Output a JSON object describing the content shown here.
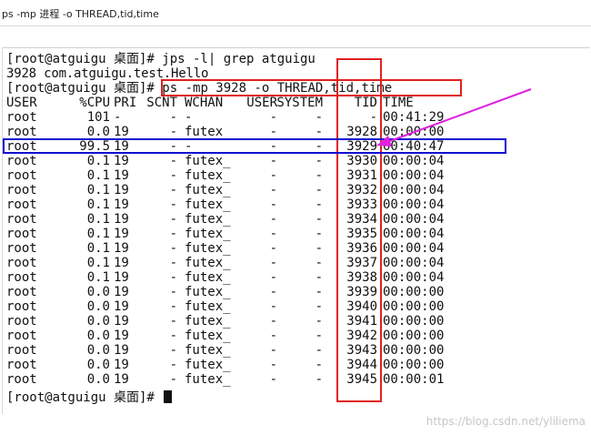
{
  "window": {
    "title": "ps -mp 进程 -o THREAD,tid,time"
  },
  "terminal": {
    "cmd1": "[root@atguigu 桌面]# jps -l| grep atguigu",
    "out1": "3928 com.atguigu.test.Hello",
    "cmd2_prefix": "[root@atguigu 桌面]# ",
    "cmd2_command": "ps -mp 3928 -o THREAD,tid,time",
    "header": [
      "USER",
      "%CPU",
      "PRI",
      "SCNT",
      "WCHAN",
      "USER",
      "SYSTEM",
      "TID",
      "TIME"
    ],
    "rows": [
      [
        "root",
        "101",
        "-",
        "-",
        "-",
        "-",
        "-",
        "-",
        "00:41:29"
      ],
      [
        "root",
        "0.0",
        "19",
        "-",
        "futex_",
        "-",
        "-",
        "3928",
        "00:00:00"
      ],
      [
        "root",
        "99.5",
        "19",
        "-",
        "-",
        "-",
        "-",
        "3929",
        "00:40:47"
      ],
      [
        "root",
        "0.1",
        "19",
        "-",
        "futex_",
        "-",
        "-",
        "3930",
        "00:00:04"
      ],
      [
        "root",
        "0.1",
        "19",
        "-",
        "futex_",
        "-",
        "-",
        "3931",
        "00:00:04"
      ],
      [
        "root",
        "0.1",
        "19",
        "-",
        "futex_",
        "-",
        "-",
        "3932",
        "00:00:04"
      ],
      [
        "root",
        "0.1",
        "19",
        "-",
        "futex_",
        "-",
        "-",
        "3933",
        "00:00:04"
      ],
      [
        "root",
        "0.1",
        "19",
        "-",
        "futex_",
        "-",
        "-",
        "3934",
        "00:00:04"
      ],
      [
        "root",
        "0.1",
        "19",
        "-",
        "futex_",
        "-",
        "-",
        "3935",
        "00:00:04"
      ],
      [
        "root",
        "0.1",
        "19",
        "-",
        "futex_",
        "-",
        "-",
        "3936",
        "00:00:04"
      ],
      [
        "root",
        "0.1",
        "19",
        "-",
        "futex_",
        "-",
        "-",
        "3937",
        "00:00:04"
      ],
      [
        "root",
        "0.1",
        "19",
        "-",
        "futex_",
        "-",
        "-",
        "3938",
        "00:00:04"
      ],
      [
        "root",
        "0.0",
        "19",
        "-",
        "futex_",
        "-",
        "-",
        "3939",
        "00:00:00"
      ],
      [
        "root",
        "0.0",
        "19",
        "-",
        "futex_",
        "-",
        "-",
        "3940",
        "00:00:00"
      ],
      [
        "root",
        "0.0",
        "19",
        "-",
        "futex_",
        "-",
        "-",
        "3941",
        "00:00:00"
      ],
      [
        "root",
        "0.0",
        "19",
        "-",
        "futex_",
        "-",
        "-",
        "3942",
        "00:00:00"
      ],
      [
        "root",
        "0.0",
        "19",
        "-",
        "futex_",
        "-",
        "-",
        "3943",
        "00:00:00"
      ],
      [
        "root",
        "0.0",
        "19",
        "-",
        "futex_",
        "-",
        "-",
        "3944",
        "00:00:00"
      ],
      [
        "root",
        "0.0",
        "19",
        "-",
        "futex_",
        "-",
        "-",
        "3945",
        "00:00:01"
      ]
    ],
    "prompt_final": "[root@atguigu 桌面]# "
  },
  "annotations": {
    "red_color": "#e02020",
    "blue_color": "#1010d0",
    "arrow_color": "#e020e0"
  },
  "watermark": "https://blog.csdn.net/yliliema"
}
